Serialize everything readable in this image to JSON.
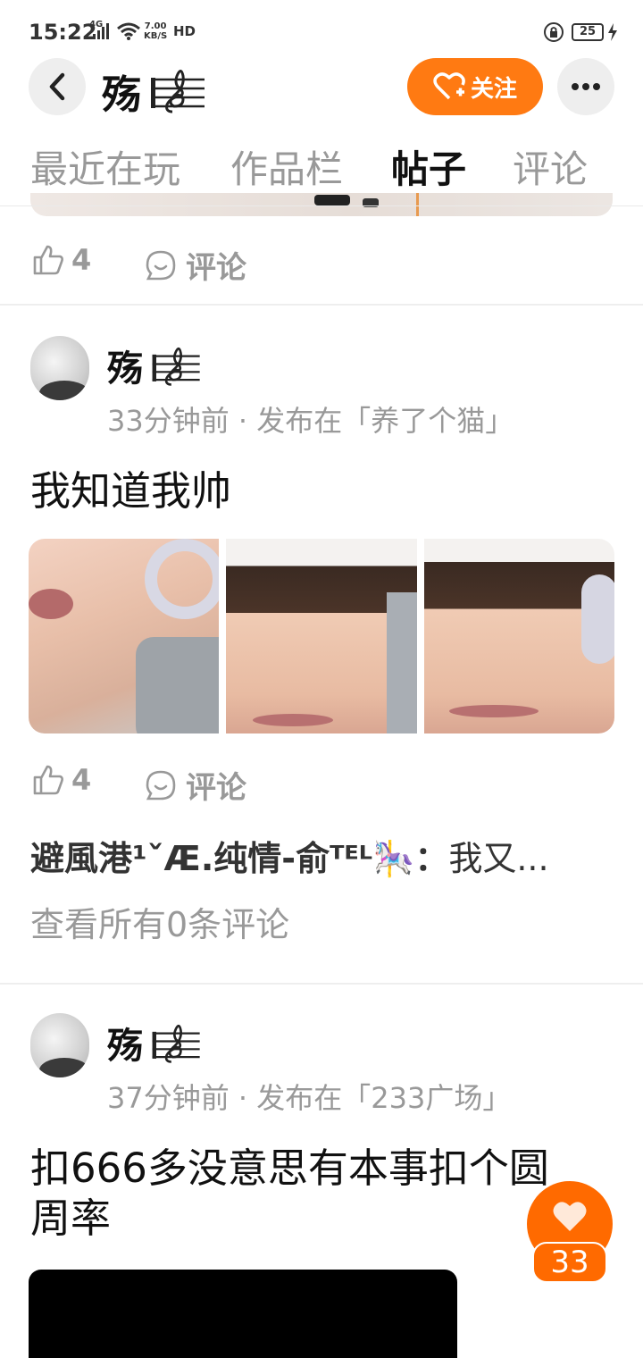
{
  "status_bar": {
    "time": "15:22",
    "network": "4G",
    "speed_value": "7.00",
    "speed_unit": "KB/S",
    "hd": "HD",
    "battery": "25"
  },
  "header": {
    "name": "殇",
    "name_badge": "music-clef-icon",
    "follow_label": "关注",
    "accent_color": "#ff7a12"
  },
  "tabs": [
    {
      "label": "最近在玩",
      "active": false
    },
    {
      "label": "作品栏",
      "active": false
    },
    {
      "label": "帖子",
      "active": true
    },
    {
      "label": "评论",
      "active": false
    }
  ],
  "prev_post": {
    "like_count": "4",
    "comment_label": "评论"
  },
  "posts": [
    {
      "author": "殇",
      "meta": "33分钟前 · 发布在「养了个猫」",
      "text": "我知道我帅",
      "image_count": 3,
      "like_count": "4",
      "comment_label": "评论",
      "comment_author": "避風港¹ˇÆ.纯情-俞ᵀᴱᴸ🎠：",
      "comment_text": "我又...",
      "view_all": "查看所有0条评论"
    },
    {
      "author": "殇",
      "meta": "37分钟前 · 发布在「233广场」",
      "text_line1": "扣666多没意思有本事扣个圆",
      "text_line2": "周率"
    }
  ],
  "fab": {
    "count": "33"
  }
}
